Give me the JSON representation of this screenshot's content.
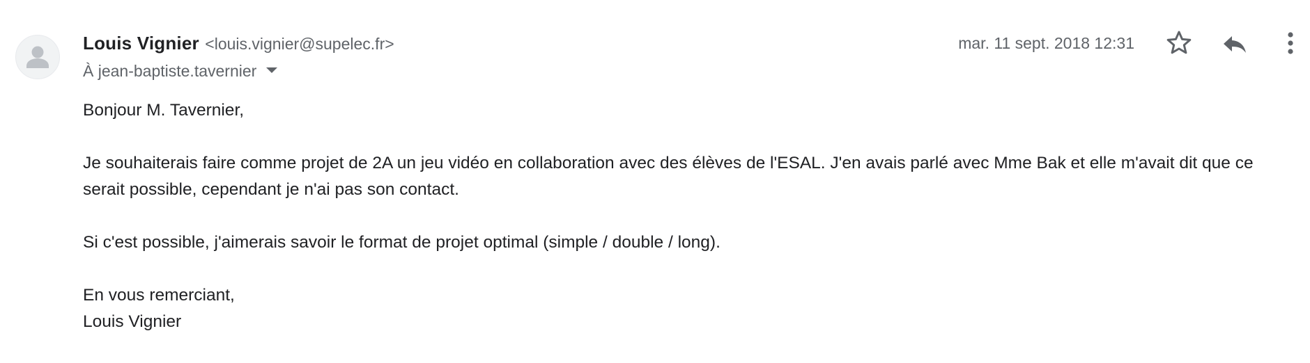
{
  "sender": {
    "name": "Louis Vignier",
    "email": "<louis.vignier@supelec.fr>"
  },
  "recipient": {
    "label": "À jean-baptiste.tavernier"
  },
  "date": "mar. 11 sept. 2018 12:31",
  "icons": {
    "avatar": "person-icon",
    "star": "star-outline-icon",
    "reply": "reply-icon",
    "more": "more-vert-icon",
    "recipient_toggle": "caret-down-icon"
  },
  "colors": {
    "text": "#202124",
    "secondary": "#5f6368",
    "icon": "#5f6368",
    "avatar_bg": "#f1f3f4",
    "avatar_glyph": "#bdc1c6"
  },
  "body": {
    "greeting": "Bonjour M. Tavernier,",
    "paragraph1": "Je souhaiterais faire comme projet de 2A un jeu vidéo en collaboration avec des élèves de l'ESAL. J'en avais parlé avec Mme Bak et elle m'avait dit que ce serait possible, cependant je n'ai pas son contact.",
    "paragraph2": "Si c'est possible, j'aimerais savoir le format de projet optimal (simple / double / long).",
    "closing": "En vous remerciant,",
    "signature": "Louis Vignier"
  }
}
